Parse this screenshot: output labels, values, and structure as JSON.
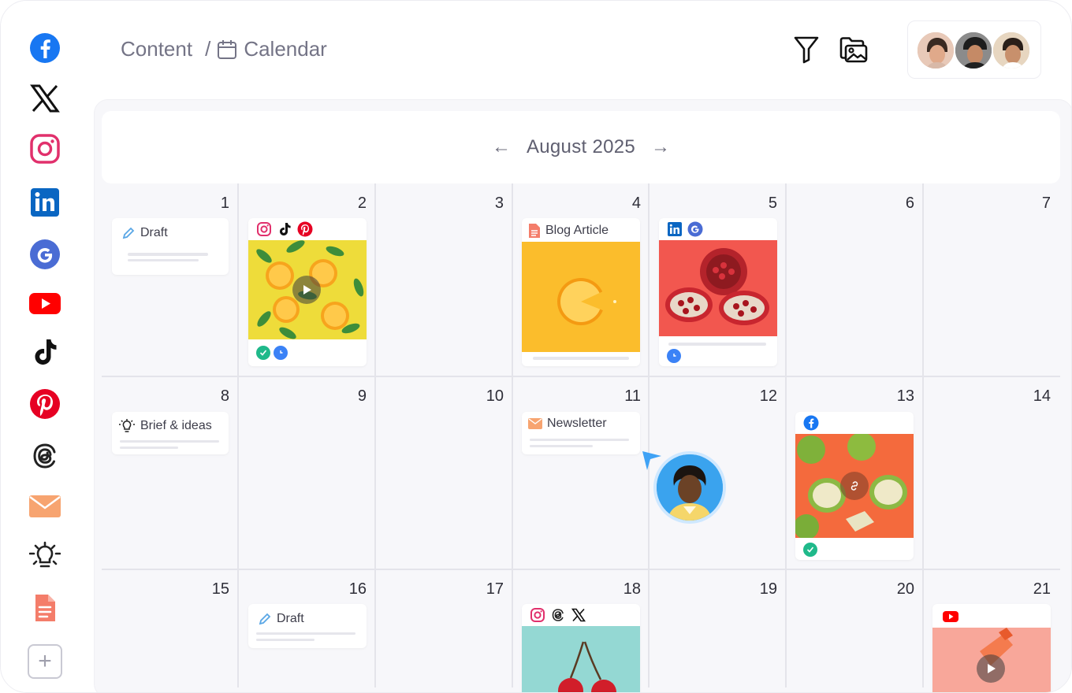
{
  "breadcrumb": {
    "root": "Content",
    "separator": "/",
    "current": "Calendar"
  },
  "calendar": {
    "month": "August 2025",
    "prev_arrow": "←",
    "next_arrow": "→"
  },
  "days": {
    "d1": "1",
    "d2": "2",
    "d3": "3",
    "d4": "4",
    "d5": "5",
    "d6": "6",
    "d7": "7",
    "d8": "8",
    "d9": "9",
    "d10": "10",
    "d11": "11",
    "d12": "12",
    "d13": "13",
    "d14": "14",
    "d15": "15",
    "d16": "16",
    "d17": "17",
    "d18": "18",
    "d19": "19",
    "d20": "20",
    "d21": "21"
  },
  "cards": {
    "draft_1": "Draft",
    "blog_4": "Blog Article",
    "brief_8": "Brief & ideas",
    "newsletter_11": "Newsletter",
    "draft_16": "Draft"
  },
  "sidebar_icons": [
    "facebook-icon",
    "x-icon",
    "instagram-icon",
    "linkedin-icon",
    "google-icon",
    "youtube-icon",
    "tiktok-icon",
    "pinterest-icon",
    "threads-icon",
    "email-icon",
    "idea-icon",
    "document-icon",
    "add-icon"
  ],
  "colors": {
    "facebook": "#1877f2",
    "instagram": "#e1306c",
    "linkedin": "#0a66c2",
    "google": "#4a6cd4",
    "youtube": "#ff0000",
    "pinterest": "#e60023",
    "email": "#f7a470",
    "document": "#f47d6a",
    "status_ok": "#1fb98a",
    "status_scheduled": "#3b82f6"
  }
}
